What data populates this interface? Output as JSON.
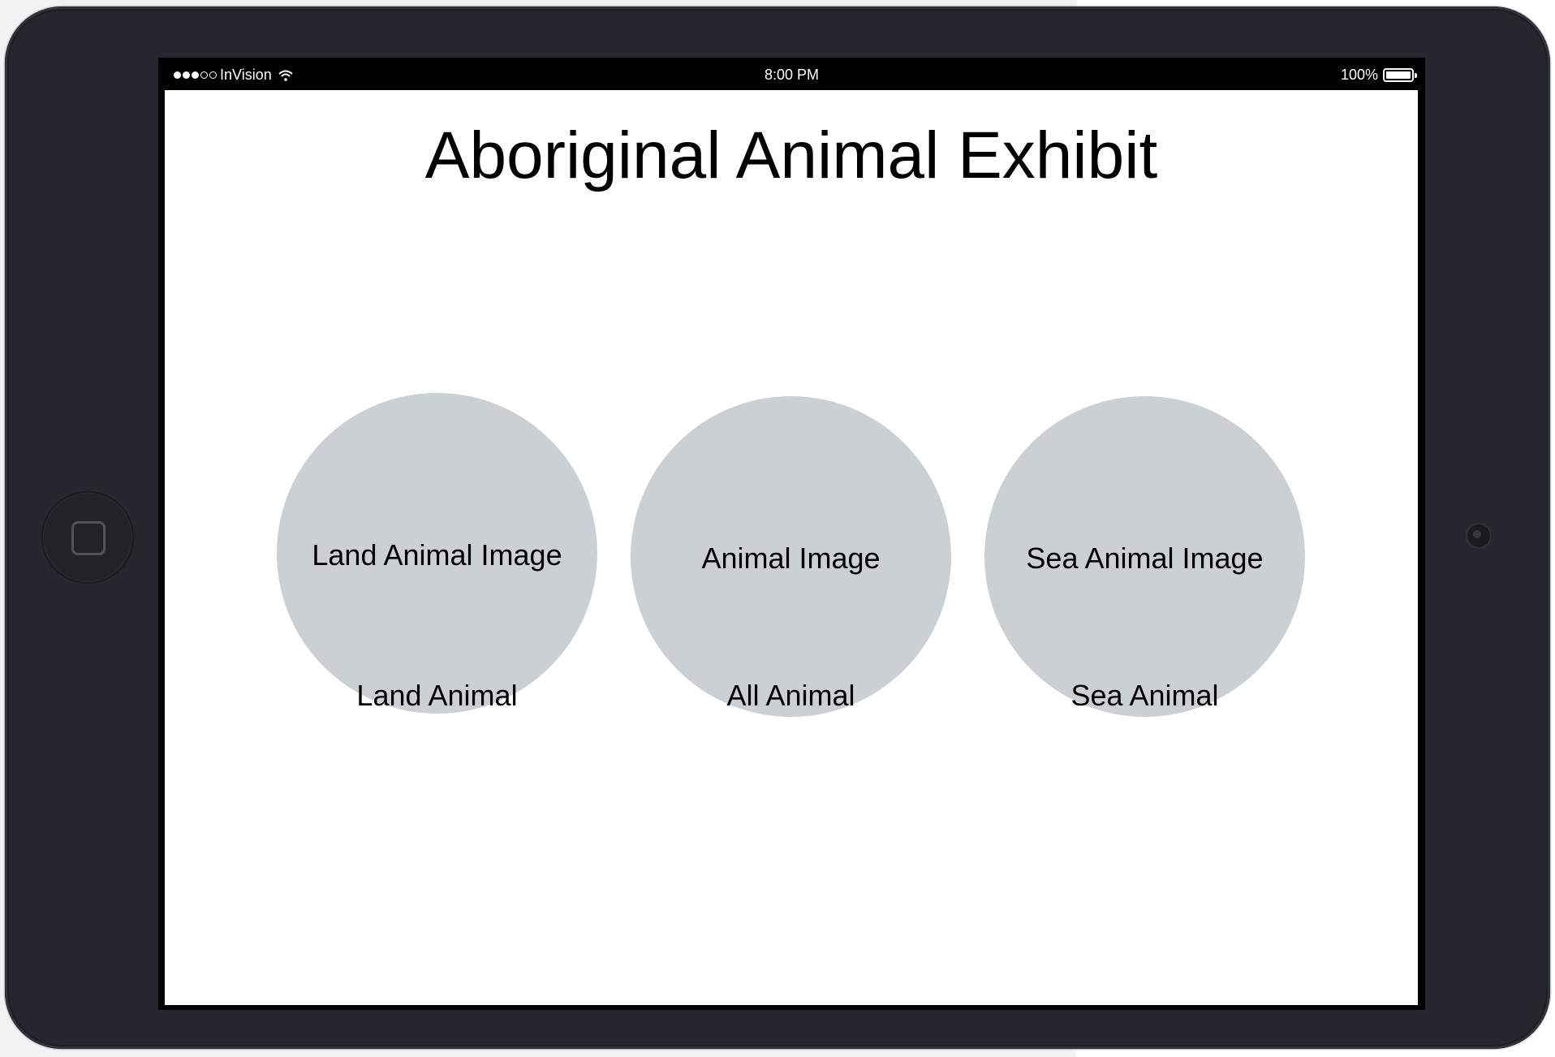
{
  "status_bar": {
    "carrier": "InVision",
    "signal_full": 3,
    "signal_empty": 2,
    "time": "8:00 PM",
    "battery_percent": "100%",
    "battery_level": 1.0
  },
  "page": {
    "title": "Aboriginal Animal Exhibit"
  },
  "categories": [
    {
      "image_label": "Land Animal Image",
      "caption": "Land Animal"
    },
    {
      "image_label": "Animal Image",
      "caption": "All Animal"
    },
    {
      "image_label": "Sea Animal Image",
      "caption": "Sea Animal"
    }
  ],
  "colors": {
    "device_frame": "#24272d",
    "placeholder_circle": "#cbd0d5",
    "screen_background": "#ffffff"
  }
}
